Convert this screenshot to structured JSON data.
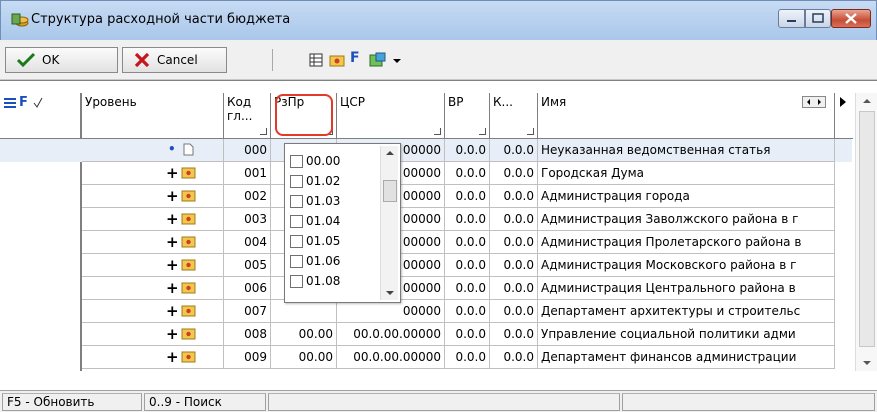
{
  "window": {
    "title": "Структура расходной части бюджета"
  },
  "toolbar": {
    "ok_label": "OK",
    "cancel_label": "Cancel",
    "f_label": "F"
  },
  "grid": {
    "corner_f": "F",
    "columns": {
      "level": "Уровень",
      "kod": "Код гл...",
      "rzpr": "РзПр",
      "csr": "ЦСР",
      "vr": "ВР",
      "k": "К...",
      "name": "Имя"
    },
    "rows": [
      {
        "kod": "000",
        "rzpr": "",
        "csr": "00000",
        "vr": "0.0.0",
        "k": "0.0.0",
        "name": "Неуказанная ведомственная статья"
      },
      {
        "kod": "001",
        "rzpr": "",
        "csr": "00000",
        "vr": "0.0.0",
        "k": "0.0.0",
        "name": "Городская Дума"
      },
      {
        "kod": "002",
        "rzpr": "",
        "csr": "00000",
        "vr": "0.0.0",
        "k": "0.0.0",
        "name": "Администрация города"
      },
      {
        "kod": "003",
        "rzpr": "",
        "csr": "00000",
        "vr": "0.0.0",
        "k": "0.0.0",
        "name": "Администрация Заволжского района в г"
      },
      {
        "kod": "004",
        "rzpr": "",
        "csr": "00000",
        "vr": "0.0.0",
        "k": "0.0.0",
        "name": "Администрация Пролетарского района в"
      },
      {
        "kod": "005",
        "rzpr": "",
        "csr": "00000",
        "vr": "0.0.0",
        "k": "0.0.0",
        "name": "Администрация Московского района в г"
      },
      {
        "kod": "006",
        "rzpr": "",
        "csr": "00000",
        "vr": "0.0.0",
        "k": "0.0.0",
        "name": "Администрация Центрального района в"
      },
      {
        "kod": "007",
        "rzpr": "",
        "csr": "00000",
        "vr": "0.0.0",
        "k": "0.0.0",
        "name": "Департамент архитектуры и строительс"
      },
      {
        "kod": "008",
        "rzpr": "00.00",
        "csr": "00.0.00.00000",
        "vr": "0.0.0",
        "k": "0.0.0",
        "name": "Управление социальной политики адми"
      },
      {
        "kod": "009",
        "rzpr": "00.00",
        "csr": "00.0.00.00000",
        "vr": "0.0.0",
        "k": "0.0.0",
        "name": "Департамент финансов администрации"
      }
    ]
  },
  "filter_popup": {
    "items": [
      "00.00",
      "01.02",
      "01.03",
      "01.04",
      "01.05",
      "01.06",
      "01.08"
    ]
  },
  "status": {
    "refresh": "F5 - Обновить",
    "search": "0..9 - Поиск"
  },
  "colors": {
    "accent": "#e2392b",
    "selected_row": "#e8eef8"
  }
}
